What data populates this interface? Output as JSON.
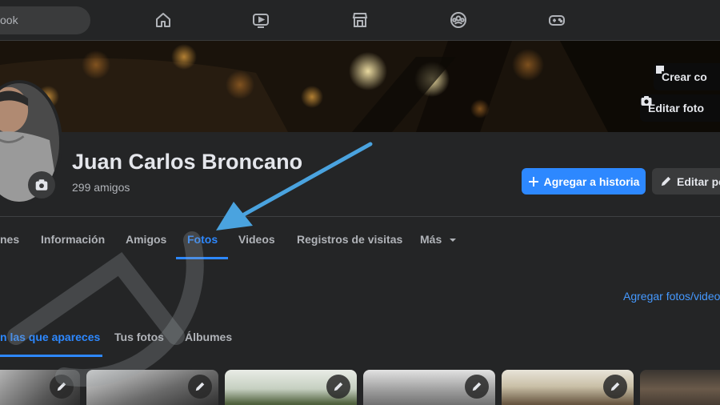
{
  "topbar": {
    "search_text": "ook",
    "nav_icons": [
      "home-icon",
      "watch-icon",
      "marketplace-icon",
      "groups-icon",
      "gaming-icon"
    ]
  },
  "cover": {
    "create_label": "Crear co",
    "edit_photo_label": "Editar foto"
  },
  "profile": {
    "name": "Juan Carlos Broncano",
    "friends": "299 amigos",
    "add_story_label": "Agregar a historia",
    "edit_profile_label": "Editar pe"
  },
  "tabs": [
    {
      "label": "nes"
    },
    {
      "label": "Información"
    },
    {
      "label": "Amigos"
    },
    {
      "label": "Fotos"
    },
    {
      "label": "Videos"
    },
    {
      "label": "Registros de visitas"
    },
    {
      "label": "Más"
    }
  ],
  "photos": {
    "add_link": "Agregar fotos/video",
    "subtabs": [
      {
        "label": "n las que apareces"
      },
      {
        "label": "Tus fotos"
      },
      {
        "label": "Álbumes"
      }
    ]
  },
  "colors": {
    "accent": "#2d88ff",
    "annotation_arrow": "#4aa3df"
  }
}
